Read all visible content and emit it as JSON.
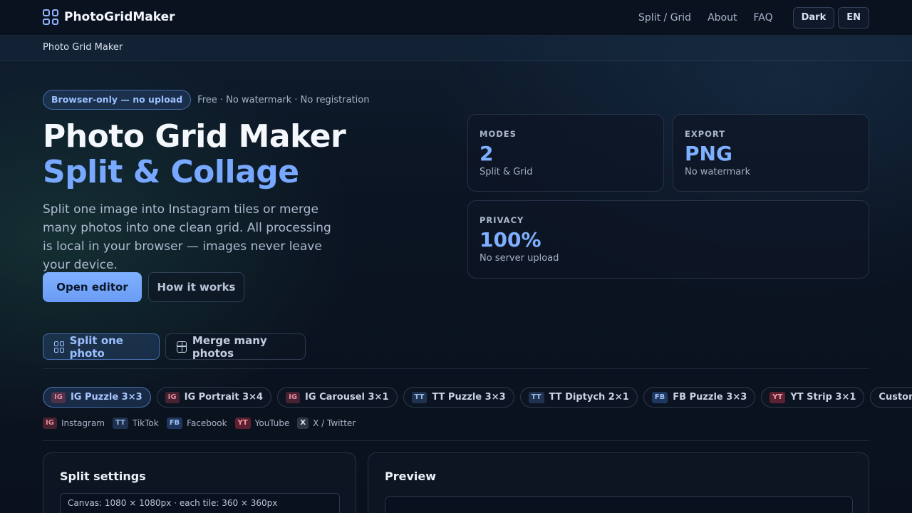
{
  "brand": {
    "name": "PhotoGridMaker"
  },
  "nav": {
    "links": [
      "Split / Grid",
      "About",
      "FAQ"
    ],
    "theme_label": "Dark",
    "lang_label": "EN"
  },
  "breadcrumb": "Photo Grid Maker",
  "hero": {
    "badge": "Browser-only — no upload",
    "badge_note": "Free · No watermark · No registration",
    "title_line1": "Photo Grid Maker",
    "title_line2": "Split & Collage",
    "lead": "Split one image into Instagram tiles or merge many photos into one clean grid. All processing is local in your browser — images never leave your device.",
    "primary_cta": "Open editor",
    "secondary_cta": "How it works"
  },
  "stats": [
    {
      "label": "MODES",
      "value": "2",
      "sub": "Split & Grid"
    },
    {
      "label": "EXPORT",
      "value": "PNG",
      "sub": "No watermark"
    },
    {
      "label": "PRIVACY",
      "value": "100%",
      "sub": "No server upload"
    }
  ],
  "mode_tabs": [
    {
      "label": "Split one photo",
      "active": true,
      "icon": "grid-2x2-icon"
    },
    {
      "label": "Merge many photos",
      "active": false,
      "icon": "grid-square-icon"
    }
  ],
  "presets": [
    {
      "tag": "IG",
      "label": "IG Puzzle 3×3",
      "active": true
    },
    {
      "tag": "IG",
      "label": "IG Portrait 3×4",
      "active": false
    },
    {
      "tag": "IG",
      "label": "IG Carousel 3×1",
      "active": false
    },
    {
      "tag": "TT",
      "label": "TT Puzzle 3×3",
      "active": false
    },
    {
      "tag": "TT",
      "label": "TT Diptych 2×1",
      "active": false
    },
    {
      "tag": "FB",
      "label": "FB Puzzle 3×3",
      "active": false
    },
    {
      "tag": "YT",
      "label": "YT Strip 3×1",
      "active": false
    },
    {
      "tag": "",
      "label": "Custom",
      "active": false
    }
  ],
  "platforms": [
    {
      "tag": "IG",
      "name": "Instagram"
    },
    {
      "tag": "TT",
      "name": "TikTok"
    },
    {
      "tag": "FB",
      "name": "Facebook"
    },
    {
      "tag": "YT",
      "name": "YouTube"
    },
    {
      "tag": "X",
      "name": "X / Twitter"
    }
  ],
  "split_settings": {
    "title": "Split settings",
    "canvas_info": "Canvas: 1080 × 1080px · each tile: 360 × 360px"
  },
  "preview": {
    "title": "Preview"
  },
  "colors": {
    "accent": "#7fb0ff",
    "background": "#0b1422"
  }
}
